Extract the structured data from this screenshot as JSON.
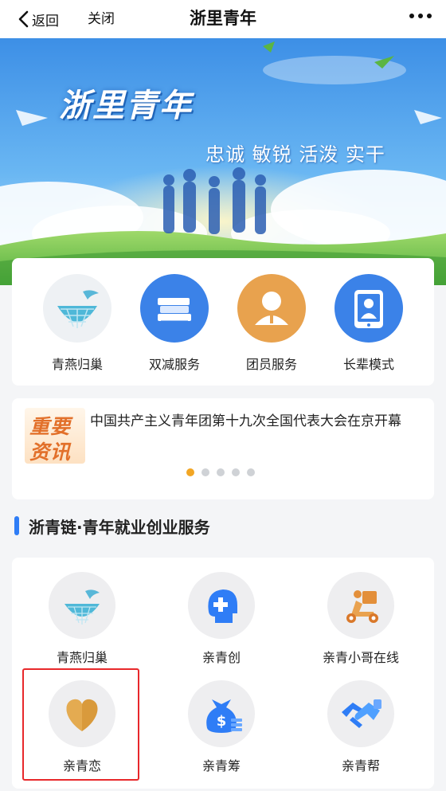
{
  "nav": {
    "back_label": "返回",
    "close_label": "关闭",
    "title": "浙里青年"
  },
  "banner": {
    "title": "浙里青年",
    "slogan": "忠诚 敏锐 活泼 实干"
  },
  "quick_services": [
    {
      "label": "青燕归巢",
      "icon": "nest-icon"
    },
    {
      "label": "双减服务",
      "icon": "books-icon"
    },
    {
      "label": "团员服务",
      "icon": "member-icon"
    },
    {
      "label": "长辈模式",
      "icon": "elder-tablet-icon"
    }
  ],
  "news": {
    "badge_line1": "重要",
    "badge_line2": "资讯",
    "headline": "中国共产主义青年团第十九次全国代表大会在京开幕",
    "dots_total": 5,
    "active_dot": 0
  },
  "section": {
    "title": "浙青链·青年就业创业服务"
  },
  "services": [
    {
      "label": "青燕归巢",
      "icon": "nest-icon"
    },
    {
      "label": "亲青创",
      "icon": "puzzle-head-icon"
    },
    {
      "label": "亲青小哥在线",
      "icon": "delivery-scooter-icon"
    },
    {
      "label": "亲青恋",
      "icon": "heart-icon"
    },
    {
      "label": "亲青筹",
      "icon": "money-bag-icon"
    },
    {
      "label": "亲青帮",
      "icon": "handshake-icon"
    }
  ],
  "colors": {
    "accent": "#2f7df6",
    "highlight": "#e8282b",
    "dot_active": "#f2a624",
    "badge_text": "#e2702a"
  }
}
